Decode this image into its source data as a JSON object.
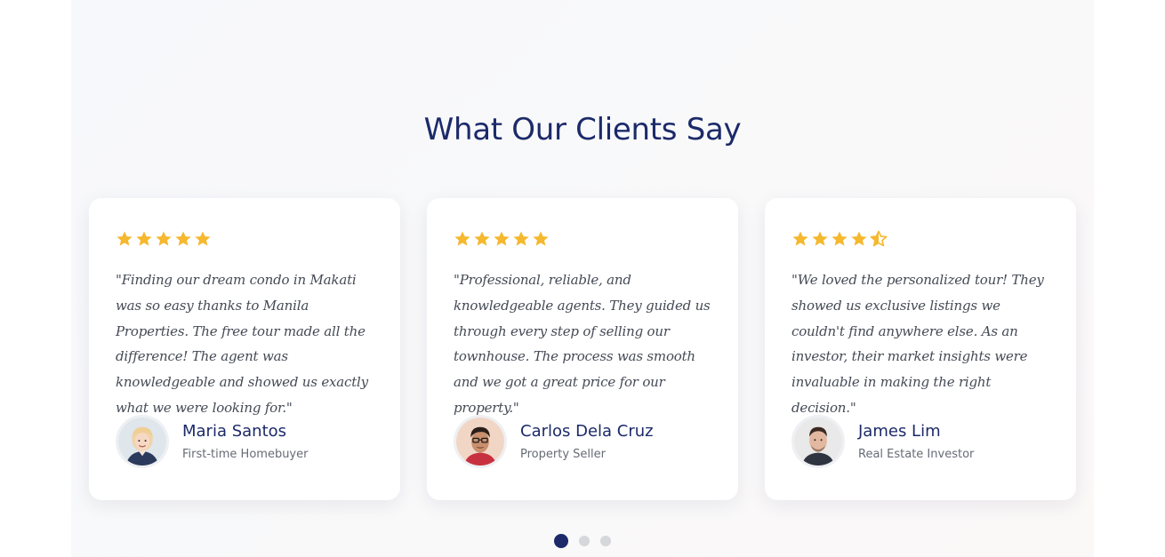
{
  "section": {
    "title": "What Our Clients Say"
  },
  "colors": {
    "heading": "#1c2a69",
    "star": "#f5b82e",
    "dot_active": "#1c2a69",
    "dot_inactive": "#d6d7da"
  },
  "testimonials": [
    {
      "rating": 5,
      "quote": "\"Finding our dream condo in Makati was so easy thanks to Manila Properties. The free tour made all the difference! The agent was knowledgeable and showed us exactly what we were looking for.\"",
      "name": "Maria Santos",
      "role": "First-time Homebuyer",
      "avatar": "woman-avatar"
    },
    {
      "rating": 5,
      "quote": "\"Professional, reliable, and knowledgeable agents. They guided us through every step of selling our townhouse. The process was smooth and we got a great price for our property.\"",
      "name": "Carlos Dela Cruz",
      "role": "Property Seller",
      "avatar": "man-glasses-avatar"
    },
    {
      "rating": 4.5,
      "quote": "\"We loved the personalized tour! They showed us exclusive listings we couldn't find anywhere else. As an investor, their market insights were invaluable in making the right decision.\"",
      "name": "James Lim",
      "role": "Real Estate Investor",
      "avatar": "man-avatar"
    }
  ],
  "carousel": {
    "total": 3,
    "active": 1
  }
}
